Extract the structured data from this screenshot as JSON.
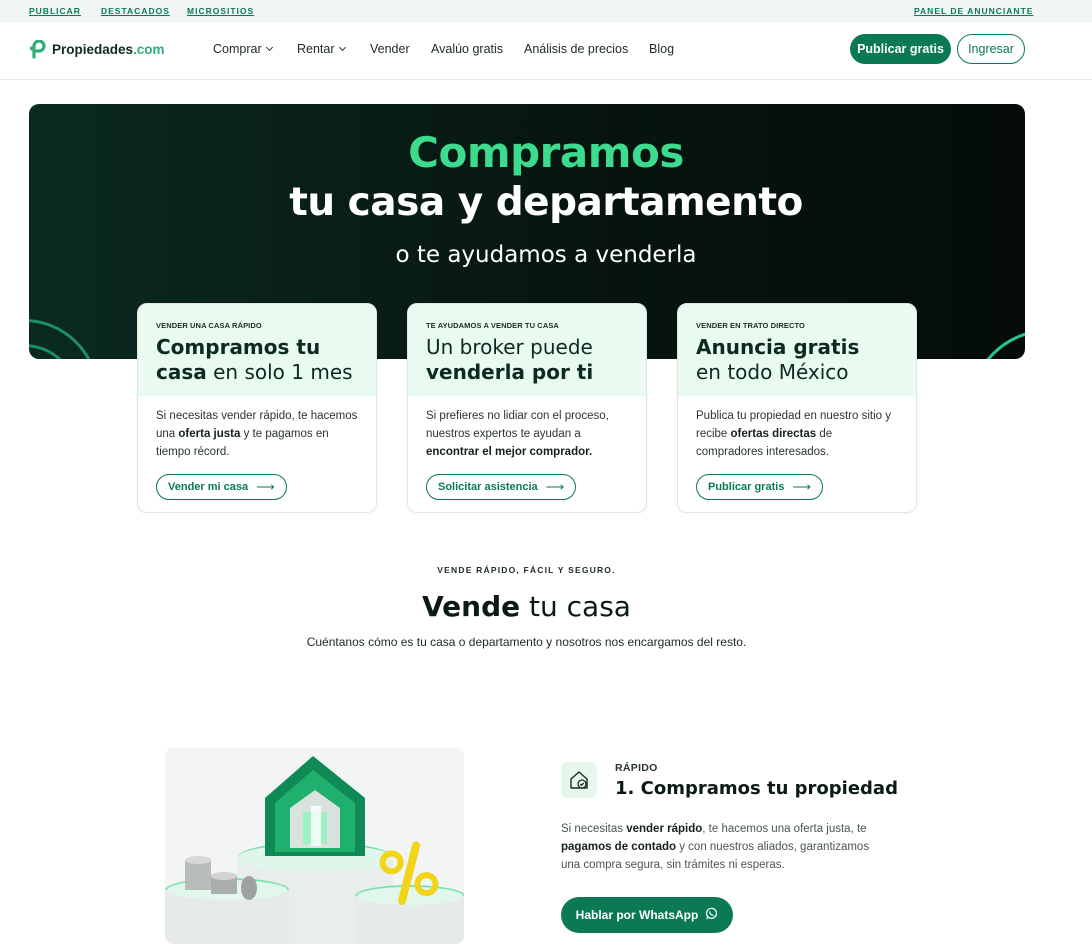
{
  "topbar": {
    "left_links": [
      "PUBLICAR",
      "DESTACADOS",
      "MICROSITIOS"
    ],
    "right_link": "PANEL DE ANUNCIANTE"
  },
  "header": {
    "logo_name": "Propiedades",
    "logo_suffix": ".com",
    "nav": [
      "Comprar",
      "Rentar",
      "Vender",
      "Avalúo gratis",
      "Análisis de precios",
      "Blog"
    ],
    "publish_label": "Publicar gratis",
    "login_label": "Ingresar"
  },
  "hero": {
    "title_line1": "Compramos",
    "title_line2": "tu casa y departamento",
    "subtitle": "o te ayudamos a venderla"
  },
  "cards": [
    {
      "eyebrow": "VENDER UNA CASA RÁPIDO",
      "title_a": "Compramos tu",
      "title_b": "casa",
      "title_c": " en solo 1 mes",
      "desc_a": "Si necesitas vender rápido, te hacemos una ",
      "desc_b": "oferta justa",
      "desc_c": " y te pagamos en tiempo récord.",
      "button": "Vender mi casa"
    },
    {
      "eyebrow": "TE AYUDAMOS A VENDER TU CASA",
      "title_a": "Un broker puede",
      "title_b": "venderla por ti",
      "desc_a": "Si prefieres no lidiar con el proceso, nuestros expertos te ayudan a ",
      "desc_b": "encontrar el mejor comprador.",
      "button": "Solicitar asistencia"
    },
    {
      "eyebrow": "VENDER EN TRATO DIRECTO",
      "title_a": "Anuncia gratis",
      "title_b": "en todo México",
      "desc_a": "Publica tu propiedad en nuestro sitio y recibe ",
      "desc_b": "ofertas directas",
      "desc_c": " de compradores interesados.",
      "button": "Publicar gratis"
    }
  ],
  "section": {
    "eyebrow": "VENDE RÁPIDO, FÁCIL Y SEGURO.",
    "title_bold": "Vende",
    "title_rest": " tu casa",
    "subtitle": "Cuéntanos cómo es tu casa o departamento y nosotros nos encargamos del resto."
  },
  "feature": {
    "eyebrow": "RÁPIDO",
    "title": "1. Compramos tu propiedad",
    "desc_a": "Si necesitas ",
    "desc_b": "vender rápido",
    "desc_c": ", te hacemos una oferta justa, te ",
    "desc_d": "pagamos de contado",
    "desc_e": " y con nuestros aliados, garantizamos una compra segura, sin trámites ni esperas.",
    "button": "Hablar por WhatsApp",
    "illustration_badge": "%"
  },
  "colors": {
    "brand": "#0b7a52",
    "accent": "#3ddb8e",
    "hero_bg": "#07150f",
    "card_top": "#e9fbf1"
  },
  "icons": [
    "logo-mark-icon",
    "chevron-down-icon",
    "arrow-right-icon",
    "house-check-icon",
    "whatsapp-icon"
  ]
}
